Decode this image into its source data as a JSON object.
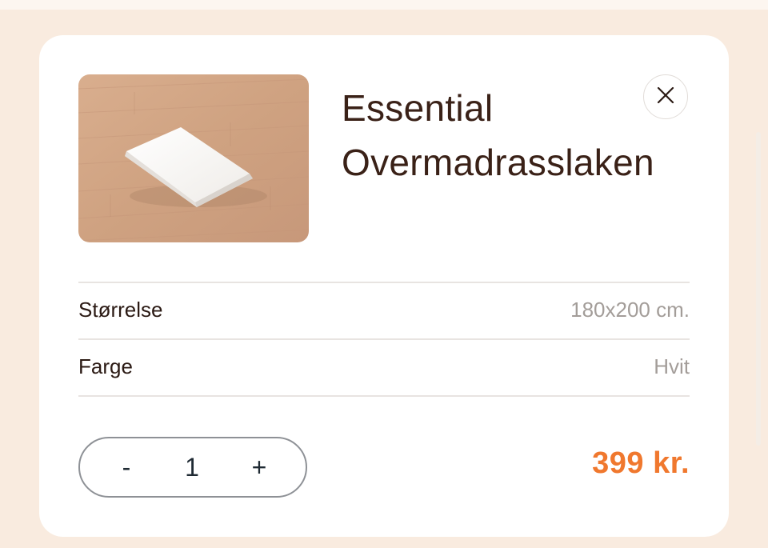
{
  "product": {
    "title_line1": "Essential",
    "title_line2": "Overmadrasslaken",
    "image_alt": "Folded white mattress topper sheet on wooden floor",
    "price": "399 kr."
  },
  "attributes": [
    {
      "label": "Størrelse",
      "value": "180x200 cm."
    },
    {
      "label": "Farge",
      "value": "Hvit"
    }
  ],
  "quantity": {
    "decrement_label": "-",
    "value": "1",
    "increment_label": "+"
  },
  "icons": {
    "close": "close-icon"
  },
  "colors": {
    "page_background": "#f9ebdf",
    "card_background": "#ffffff",
    "title_text": "#3a2117",
    "price_accent": "#f0782e",
    "muted_value": "#a39d99"
  }
}
